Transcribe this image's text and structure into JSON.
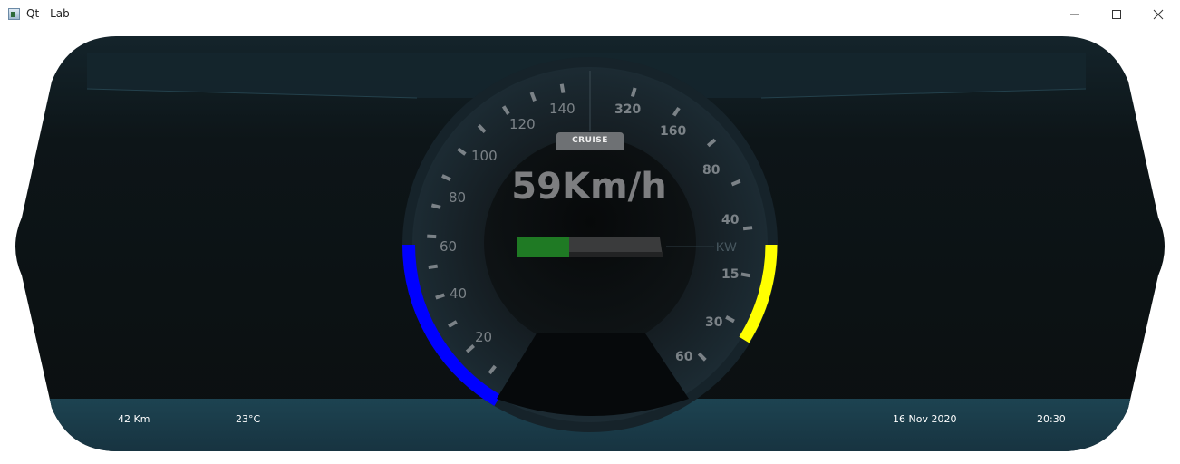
{
  "window": {
    "title": "Qt - Lab"
  },
  "speedometer": {
    "speed_text": "59Km/h",
    "cruise_label": "CRUISE",
    "power_unit": "KW",
    "speed_tick_labels": [
      "20",
      "40",
      "60",
      "80",
      "100",
      "120",
      "140"
    ],
    "right_scale_labels": [
      "320",
      "160",
      "80",
      "40",
      "15",
      "30",
      "60"
    ],
    "power_bar_level": 0.36,
    "colors": {
      "left_arc": "#0000ff",
      "right_arc": "#ffff00",
      "power_bar_fill": "#1f7a24"
    }
  },
  "info_bar": {
    "odometer": "42 Km",
    "temperature": "23°C",
    "date": "16 Nov 2020",
    "time": "20:30"
  }
}
